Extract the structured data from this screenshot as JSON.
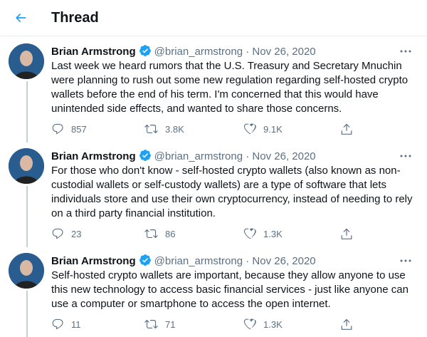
{
  "header": {
    "title": "Thread"
  },
  "tweets": [
    {
      "name": "Brian Armstrong",
      "handle": "@brian_armstrong",
      "separator": "·",
      "date": "Nov 26, 2020",
      "text": "Last week we heard rumors that the U.S. Treasury and Secretary Mnuchin were planning to rush out some new regulation regarding self-hosted crypto wallets before the end of his term. I'm concerned that this would have unintended side effects, and wanted to share those concerns.",
      "replies": "857",
      "retweets": "3.8K",
      "likes": "9.1K"
    },
    {
      "name": "Brian Armstrong",
      "handle": "@brian_armstrong",
      "separator": "·",
      "date": "Nov 26, 2020",
      "text": "For those who don't know - self-hosted crypto wallets (also known as non-custodial wallets or self-custody wallets) are a type of software that lets individuals store and use their own cryptocurrency, instead of needing to rely on a third party financial institution.",
      "replies": "23",
      "retweets": "86",
      "likes": "1.3K"
    },
    {
      "name": "Brian Armstrong",
      "handle": "@brian_armstrong",
      "separator": "·",
      "date": "Nov 26, 2020",
      "text": "Self-hosted crypto wallets are important, because they allow anyone to use this new technology to access basic financial services - just like anyone can use a computer or smartphone to access the open internet.",
      "replies": "11",
      "retweets": "71",
      "likes": "1.3K"
    }
  ],
  "colors": {
    "accent": "#1da1f2",
    "muted": "#5b7083",
    "thread_line": "#c4cfd6"
  },
  "icons": [
    "back-arrow-icon",
    "verified-badge-icon",
    "more-icon",
    "reply-icon",
    "retweet-icon",
    "like-icon",
    "share-icon"
  ]
}
